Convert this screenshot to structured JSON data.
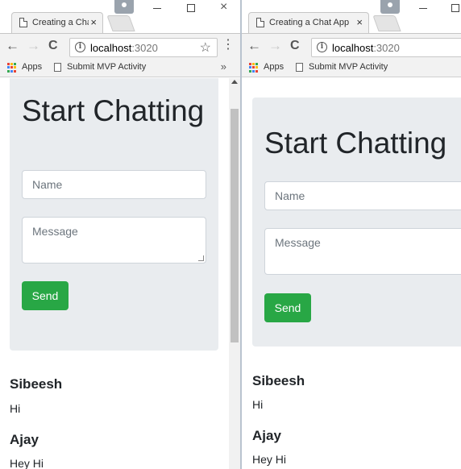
{
  "windows": [
    {
      "tab_title": "Creating a Chat App",
      "url_host": "localhost",
      "url_port": ":3020",
      "bookmarks": {
        "apps_label": "Apps",
        "item_label": "Submit MVP Activity",
        "more": "»"
      },
      "app": {
        "heading": "Start Chatting",
        "name_placeholder": "Name",
        "message_placeholder": "Message",
        "send_label": "Send",
        "messages": [
          {
            "name": "Sibeesh",
            "text": "Hi"
          },
          {
            "name": "Ajay",
            "text": "Hey Hi"
          }
        ]
      }
    },
    {
      "tab_title": "Creating a Chat App",
      "url_host": "localhost",
      "url_port": ":3020",
      "bookmarks": {
        "apps_label": "Apps",
        "item_label": "Submit MVP Activity"
      },
      "app": {
        "heading": "Start Chatting",
        "name_placeholder": "Name",
        "message_placeholder": "Message",
        "send_label": "Send",
        "messages": [
          {
            "name": "Sibeesh",
            "text": "Hi"
          },
          {
            "name": "Ajay",
            "text": "Hey Hi"
          }
        ]
      }
    }
  ],
  "icons": {
    "close": "×",
    "back": "←",
    "forward": "→",
    "reload": "C",
    "info": "i",
    "star": "☆",
    "menu": "⋮",
    "minimize": "—",
    "maximize": "□",
    "window_close": "×"
  },
  "colors": {
    "send_button": "#28a745",
    "jumbotron_bg": "#e9ecef",
    "chrome_toolbar": "#f2f2f2"
  }
}
